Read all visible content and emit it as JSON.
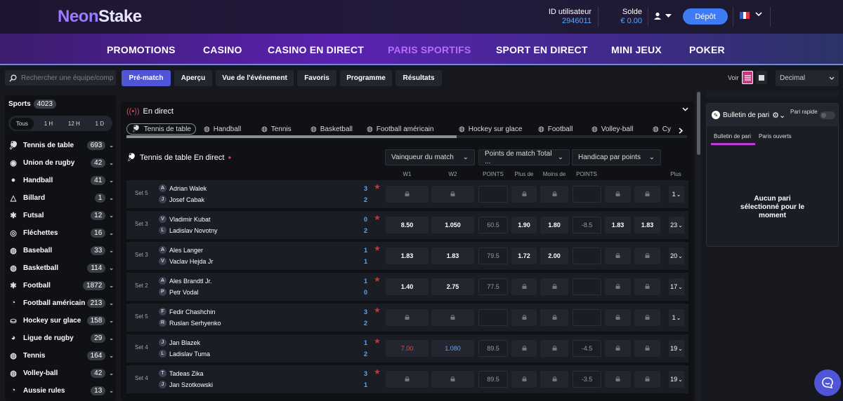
{
  "header": {
    "logo_part1": "Neon",
    "logo_part2": "Stake",
    "user_id_label": "ID utilisateur",
    "user_id_value": "2946011",
    "balance_label": "Solde",
    "balance_value": "€ 0.00",
    "deposit_label": "Dépôt"
  },
  "nav": [
    "PROMOTIONS",
    "CASINO",
    "CASINO EN DIRECT",
    "PARIS SPORTIFS",
    "SPORT EN DIRECT",
    "MINI JEUX",
    "POKER"
  ],
  "nav_active": "PARIS SPORTIFS",
  "search": {
    "placeholder": "Rechercher une équipe/comp"
  },
  "tabs": [
    "Pré-match",
    "Aperçu",
    "Vue de l'événement",
    "Favoris",
    "Programme",
    "Résultats"
  ],
  "view": {
    "label": "Voir",
    "odds_format": "Decimal"
  },
  "sidebar": {
    "title": "Sports",
    "total": "4023",
    "time_filters": [
      "Tous",
      "1 H",
      "12 H",
      "1 D"
    ],
    "items": [
      {
        "label": "Tennis de table",
        "count": "693",
        "icon": "table-tennis-icon"
      },
      {
        "label": "Union de rugby",
        "count": "42",
        "icon": "rugby-icon"
      },
      {
        "label": "Handball",
        "count": "41",
        "icon": "handball-icon"
      },
      {
        "label": "Billard",
        "count": "1",
        "icon": "billiards-icon"
      },
      {
        "label": "Futsal",
        "count": "12",
        "icon": "futsal-icon"
      },
      {
        "label": "Fléchettes",
        "count": "16",
        "icon": "darts-icon"
      },
      {
        "label": "Baseball",
        "count": "33",
        "icon": "baseball-icon"
      },
      {
        "label": "Basketball",
        "count": "114",
        "icon": "basketball-icon"
      },
      {
        "label": "Football",
        "count": "1872",
        "icon": "football-icon"
      },
      {
        "label": "Football américain",
        "count": "213",
        "icon": "american-football-icon"
      },
      {
        "label": "Hockey sur glace",
        "count": "158",
        "icon": "ice-hockey-icon"
      },
      {
        "label": "Ligue de rugby",
        "count": "29",
        "icon": "rugby-league-icon"
      },
      {
        "label": "Tennis",
        "count": "164",
        "icon": "tennis-icon"
      },
      {
        "label": "Volley-ball",
        "count": "42",
        "icon": "volleyball-icon"
      },
      {
        "label": "Aussie rules",
        "count": "13",
        "icon": "aussie-rules-icon"
      }
    ]
  },
  "main": {
    "live_label": "En direct",
    "sport_tabs": [
      "Tennis de table",
      "Handball",
      "Tennis",
      "Basketball",
      "Football américain",
      "Hockey sur glace",
      "Football",
      "Volley-ball",
      "Cy"
    ],
    "section_title": "Tennis de table En direct",
    "dropdowns": [
      "Vainqueur du match",
      "Points de match Total ...",
      "Handicap par points"
    ],
    "columns": [
      "W1",
      "W2",
      "POINTS",
      "Plus de",
      "Moins de",
      "POINTS",
      "Plus"
    ],
    "rows": [
      {
        "set": "Set 5",
        "p1": "Adrian Walek",
        "i1": "A",
        "s1": "3",
        "p2": "Josef Cabak",
        "i2": "J",
        "s2": "2",
        "w1": "",
        "w2": "",
        "pts": "",
        "over": "",
        "under": "",
        "hpts": "",
        "h1": "",
        "h2": "",
        "more": "1"
      },
      {
        "set": "Set 3",
        "p1": "Vladimir Kubat",
        "i1": "V",
        "s1": "0",
        "p2": "Ladislav Novotny",
        "i2": "L",
        "s2": "2",
        "w1": "8.50",
        "w2": "1.050",
        "pts": "60.5",
        "over": "1.90",
        "under": "1.80",
        "hpts": "-8.5",
        "h1": "1.83",
        "h2": "1.83",
        "more": "23"
      },
      {
        "set": "Set 3",
        "p1": "Ales Langer",
        "i1": "A",
        "s1": "1",
        "p2": "Vaclav Hejda Jr",
        "i2": "V",
        "s2": "1",
        "w1": "1.83",
        "w2": "1.83",
        "pts": "79.5",
        "over": "1.72",
        "under": "2.00",
        "hpts": "",
        "h1": "",
        "h2": "",
        "more": "20"
      },
      {
        "set": "Set 2",
        "p1": "Ales Brandtl Jr.",
        "i1": "A",
        "s1": "1",
        "p2": "Petr Vodal",
        "i2": "P",
        "s2": "0",
        "w1": "1.40",
        "w2": "2.75",
        "pts": "77.5",
        "over": "",
        "under": "",
        "hpts": "",
        "h1": "",
        "h2": "",
        "more": "17"
      },
      {
        "set": "Set 5",
        "p1": "Fedir Chashchin",
        "i1": "F",
        "s1": "3",
        "p2": "Ruslan Serhyenko",
        "i2": "R",
        "s2": "2",
        "w1": "",
        "w2": "",
        "pts": "",
        "over": "",
        "under": "",
        "hpts": "",
        "h1": "",
        "h2": "",
        "more": "1"
      },
      {
        "set": "Set 4",
        "p1": "Jan Blazek",
        "i1": "J",
        "s1": "1",
        "p2": "Ladislav Tuma",
        "i2": "L",
        "s2": "2",
        "w1": "7.00",
        "w2": "1.080",
        "pts": "89.5",
        "over": "",
        "under": "",
        "hpts": "-4.5",
        "h1": "",
        "h2": "",
        "more": "19"
      },
      {
        "set": "Set 4",
        "p1": "Tadeas Zika",
        "i1": "T",
        "s1": "3",
        "p2": "Jan Szotkowski",
        "i2": "J",
        "s2": "1",
        "w1": "",
        "w2": "",
        "pts": "89.5",
        "over": "",
        "under": "",
        "hpts": "-3.5",
        "h1": "",
        "h2": "",
        "more": "19"
      }
    ]
  },
  "betslip": {
    "title": "Bulletin de pari",
    "quick_bet": "Pari rapide",
    "tabs": [
      "Bulletin de pari",
      "Paris ouverts"
    ],
    "empty": "Aucun pari sélectionné pour le moment"
  },
  "colors": {
    "accent": "#4f55d6",
    "nav_active": "#b86cff",
    "score": "#59a7ff",
    "odds_down": "#e04848"
  }
}
